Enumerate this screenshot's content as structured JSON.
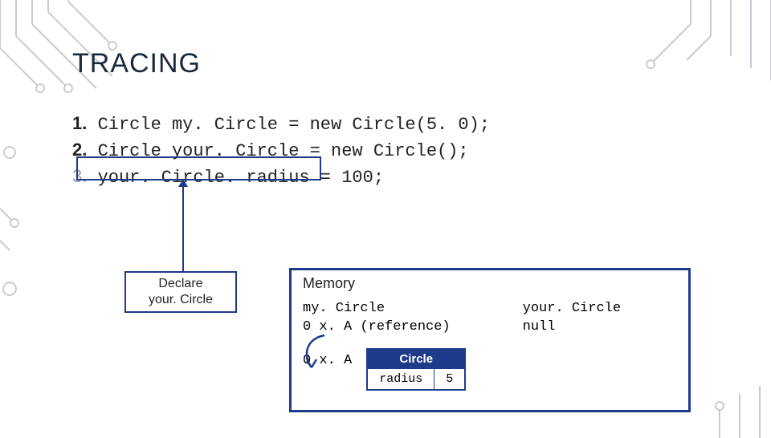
{
  "title": "TRACING",
  "code": {
    "line1_num": "1.",
    "line1": "Circle my. Circle = new Circle(5. 0);",
    "line2_num": "2.",
    "line2": "Circle your. Circle = new Circle();",
    "line3_num": "3.",
    "line3": "your. Circle. radius = 100;"
  },
  "declare": {
    "l1": "Declare",
    "l2": "your. Circle"
  },
  "memory": {
    "title": "Memory",
    "var1_name": "my. Circle",
    "var1_val": "0 x. A (reference)",
    "var2_name": "your. Circle",
    "var2_val": "null",
    "addr": "0 x. A",
    "obj_type": "Circle",
    "obj_field": "radius",
    "obj_value": "5"
  }
}
